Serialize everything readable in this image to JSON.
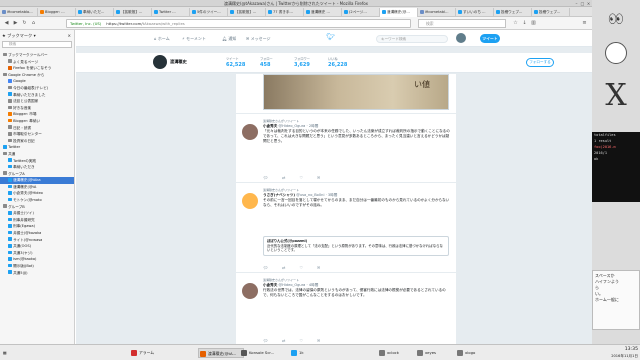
{
  "window": {
    "title": "渡溝穣史(@tAkazawa)さん | Twitterから削除されたツイート - Mozilla Firefox"
  },
  "tabs": [
    {
      "label": "ificometablo...",
      "color": "#6b8ec7"
    },
    {
      "label": "Blogger: ...",
      "color": "#f57c00"
    },
    {
      "label": "奉納いただ...",
      "color": "#1da1f2"
    },
    {
      "label": "【拡散推】...",
      "color": "#1da1f2"
    },
    {
      "label": "Twitter ...",
      "color": "#1da1f2"
    },
    {
      "label": "5件のツイー...",
      "color": "#1da1f2"
    },
    {
      "label": "【拡散推】...",
      "color": "#1da1f2"
    },
    {
      "label": "77 書き手...",
      "color": "#1da1f2"
    },
    {
      "label": "渡溝穣史 ...",
      "color": "#1da1f2"
    },
    {
      "label": "(2ページ...",
      "color": "#1da1f2"
    },
    {
      "label": "渡溝穣史(@...",
      "color": "#1da1f2",
      "active": true
    },
    {
      "label": "ificometabl...",
      "color": "#6b8ec7"
    },
    {
      "label": "すいいのち ...",
      "color": "#1da1f2"
    },
    {
      "label": "投稿ウェブ...",
      "color": "#1da1f2"
    },
    {
      "label": "投稿ウェブ...",
      "color": "#1da1f2"
    }
  ],
  "nav": {
    "url_secure": "Twitter, Inc. (US)",
    "url_host": "https://twitter.com/",
    "url_path": "tAkazawa/with_replies",
    "search_placeholder": "検索"
  },
  "sidebar": {
    "title": "ブックマーク",
    "search_placeholder": "検索",
    "items": [
      {
        "label": "ブックマークツールバー",
        "indent": 0,
        "color": "#8a8a8a"
      },
      {
        "label": "よく見るページ",
        "indent": 1,
        "color": "#8a8a8a"
      },
      {
        "label": "Firefox を使いこなそう",
        "indent": 1,
        "color": "#e66000"
      },
      {
        "label": "Google Chrome から",
        "indent": 0,
        "color": "#8a8a8a"
      },
      {
        "label": "Google",
        "indent": 1,
        "color": "#4285f4"
      },
      {
        "label": "今日の番組表(テレビ)",
        "indent": 1,
        "color": "#8a8a8a"
      },
      {
        "label": "奉納いただきました",
        "indent": 1,
        "color": "#1da1f2"
      },
      {
        "label": "法廷と公表国家",
        "indent": 1,
        "color": "#8a8a8a"
      },
      {
        "label": "好きな音楽",
        "indent": 1,
        "color": "#8a8a8a"
      },
      {
        "label": "Blogger: 市場",
        "indent": 1,
        "color": "#f57c00"
      },
      {
        "label": "Blogger: 奉納い",
        "indent": 1,
        "color": "#f57c00"
      },
      {
        "label": "日記・読書",
        "indent": 1,
        "color": "#8a8a8a"
      },
      {
        "label": "市場取引センター",
        "indent": 1,
        "color": "#8a8a8a"
      },
      {
        "label": "投資家の日記",
        "indent": 1,
        "color": "#8a8a8a"
      },
      {
        "label": "Twitter",
        "indent": 0,
        "color": "#1da1f2"
      },
      {
        "label": "共通",
        "indent": 0,
        "color": "#8a8a8a"
      },
      {
        "label": "Twitterの実践",
        "indent": 1,
        "color": "#1da1f2"
      },
      {
        "label": "奉納いただき",
        "indent": 1,
        "color": "#1da1f2"
      },
      {
        "label": "グループA",
        "indent": 0,
        "color": "#8a8a8a"
      },
      {
        "label": "渡溝穣史(@tAka",
        "indent": 1,
        "color": "#1da1f2",
        "selected": true
      },
      {
        "label": "渡溝穣史(@tA",
        "indent": 1,
        "color": "#1da1f2"
      },
      {
        "label": "小倉秀夫(@Hideo",
        "indent": 1,
        "color": "#1da1f2"
      },
      {
        "label": "モトケン(@moto",
        "indent": 1,
        "color": "#1da1f2"
      },
      {
        "label": "グループB",
        "indent": 0,
        "color": "#8a8a8a"
      },
      {
        "label": "弁護士(ツイ)",
        "indent": 1,
        "color": "#1da1f2"
      },
      {
        "label": "刑事弁護研究",
        "indent": 1,
        "color": "#1da1f2"
      },
      {
        "label": "刑事(Egawa)",
        "indent": 1,
        "color": "#1da1f2"
      },
      {
        "label": "弁護士(@kozaka",
        "indent": 1,
        "color": "#1da1f2"
      },
      {
        "label": "サイト(@ncwasa",
        "indent": 1,
        "color": "#1da1f2"
      },
      {
        "label": "共通(OOS)",
        "indent": 1,
        "color": "#1da1f2"
      },
      {
        "label": "共通3(ヤジ)",
        "indent": 1,
        "color": "#1da1f2"
      },
      {
        "label": "ism(@kaoko)",
        "indent": 1,
        "color": "#1da1f2"
      },
      {
        "label": "開示版(JBot)",
        "indent": 1,
        "color": "#1da1f2"
      },
      {
        "label": "共通5(JJ)",
        "indent": 1,
        "color": "#1da1f2"
      }
    ]
  },
  "twitter": {
    "nav_home": "ホーム",
    "nav_moments": "モーメント",
    "nav_notifications": "通知",
    "nav_messages": "メッセージ",
    "search_placeholder": "キーワード検索",
    "tweet_button": "ツイート",
    "profile_name": "渡溝穣史",
    "stats": [
      {
        "label": "ツイート",
        "value": "62,528"
      },
      {
        "label": "フォロー",
        "value": "458"
      },
      {
        "label": "フォロワー",
        "value": "3,629"
      },
      {
        "label": "いいね",
        "value": "26,228"
      }
    ],
    "follow_button": "フォローする",
    "tweets": [
      {
        "context": "渡溝穣史さんがリツイート",
        "name": "小倉秀夫",
        "handle": "@Hideo_Ogura",
        "time": "2時間",
        "body": "「元々は裁判をする目的というのが本来の任務でした、いったん法案が成立すれば裁判所の指示で動くことになるのであって、これは大きな問題だと思う」という意見が多数あるところから、まったく見当違いと言えるかどうかは疑問だと思う。",
        "avatar_color": "#8d6e63",
        "replies": "",
        "retweets": "",
        "likes": ""
      },
      {
        "context": "渡溝穣史さんがリツイート",
        "name": "うさぎ(ナベシャツ)",
        "handle": "@usa_no_Bo0ni",
        "time": "3時間",
        "body": "その前に一言一回目を落として寝かせてからのまま、まだ自分は一番最初のものから見れているのかよく分からないなら、それはいいのですがその話ね。",
        "avatar_color": "#ffb74d",
        "quote_name": "ぼぼりん公式(@pozzmi)",
        "quote_body": "近代的な法制度の原理として「法の支配」という原則があります。その意味は、行政は法律に基づかなければならないということです。"
      },
      {
        "context": "渡溝穣史さんがリツイート",
        "name": "小倉秀夫",
        "handle": "@Hideo_Ogura",
        "time": "4時間",
        "body": "行政法の世界では、法律の留保の原則というものがあって、侵害行政には法律の根拠が必要であるとされているので、何もないところで国がこんなことをするのはおかしいです。",
        "avatar_color": "#8d6e63"
      }
    ]
  },
  "desktop": {
    "term_lines": [
      "totalfiles",
      "1 result",
      "foo(2016-m",
      "2016/1",
      "ok"
    ],
    "note_lines": [
      "スペースか",
      "ハイフンよう",
      "ら",
      "い。",
      "ホーム一般に"
    ]
  },
  "taskbar": {
    "items": [
      {
        "label": "アラーム",
        "color": "#d32f2f"
      },
      {
        "label": "渡溝穣史(@tA...",
        "color": "#e66000",
        "active": true
      },
      {
        "label": "Konsole Scr...",
        "color": "#555555"
      },
      {
        "label": "1k",
        "color": "#1da1f2"
      },
      {
        "label": "xclock",
        "color": "#777777"
      },
      {
        "label": "xeyes",
        "color": "#777777"
      },
      {
        "label": "xlogo",
        "color": "#777777"
      }
    ],
    "time": "13:35",
    "date": "2016年11月1日"
  }
}
